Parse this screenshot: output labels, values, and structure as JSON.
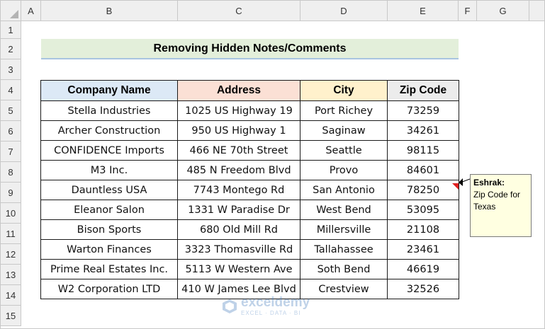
{
  "columns": [
    "A",
    "B",
    "C",
    "D",
    "E",
    "F",
    "G"
  ],
  "rows": [
    "1",
    "2",
    "3",
    "4",
    "5",
    "6",
    "7",
    "8",
    "9",
    "10",
    "11",
    "12",
    "13",
    "14",
    "15"
  ],
  "title": "Removing Hidden Notes/Comments",
  "table": {
    "headers": [
      "Company Name",
      "Address",
      "City",
      "Zip Code"
    ],
    "header_colors": [
      "#dce9f6",
      "#fbe0d5",
      "#fff1cc",
      "#ececec"
    ],
    "rows": [
      [
        "Stella Industries",
        "1025 US Highway 19",
        "Port Richey",
        "73259"
      ],
      [
        "Archer Construction",
        "950 US Highway 1",
        "Saginaw",
        "34261"
      ],
      [
        "CONFIDENCE Imports",
        "466 NE 70th Street",
        "Seattle",
        "98115"
      ],
      [
        "M3 Inc.",
        "485 N Freedom Blvd",
        "Provo",
        "84601"
      ],
      [
        "Dauntless USA",
        "7743 Montego Rd",
        "San Antonio",
        "78250"
      ],
      [
        "Eleanor Salon",
        "1331 W Paradise Dr",
        "West Bend",
        "53095"
      ],
      [
        "Bison Sports",
        "680 Old Mill Rd",
        "Millersville",
        "21108"
      ],
      [
        "Warton Finances",
        "3323 Thomasville Rd",
        "Tallahassee",
        "23461"
      ],
      [
        "Prime Real Estates Inc.",
        "5113 W Western Ave",
        "Soth Bend",
        "46619"
      ],
      [
        "W2 Corporation LTD",
        "410 W James Lee Blvd",
        "Crestview",
        "32526"
      ]
    ]
  },
  "note": {
    "author": "Eshrak:",
    "text": "Zip Code for Texas",
    "indicator_color": "#e02020"
  },
  "watermark": {
    "name": "exceldemy",
    "tagline": "EXCEL · DATA · BI"
  }
}
